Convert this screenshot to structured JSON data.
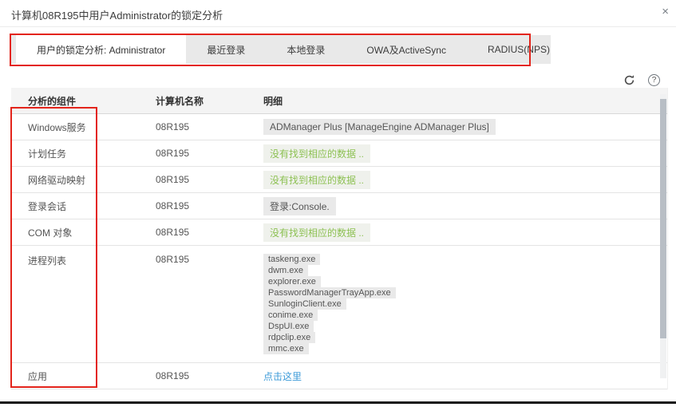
{
  "dialog": {
    "title": "计算机08R195中用户Administrator的锁定分析",
    "close_icon": "×"
  },
  "tabs": [
    {
      "id": "lockout-analysis",
      "label": "用户的锁定分析: Administrator",
      "active": true
    },
    {
      "id": "recent-logon",
      "label": "最近登录",
      "active": false
    },
    {
      "id": "local-logon",
      "label": "本地登录",
      "active": false
    },
    {
      "id": "owa-activesync",
      "label": "OWA及ActiveSync",
      "active": false
    },
    {
      "id": "radius-nps",
      "label": "RADIUS(NPS)",
      "active": false
    }
  ],
  "toolbar": {
    "help_icon": "?"
  },
  "table": {
    "columns": [
      "分析的组件",
      "计算机名称",
      "明细"
    ],
    "rows": [
      {
        "component": "Windows服务",
        "computer": "08R195",
        "detail_type": "badge",
        "detail": "ADManager Plus [ManageEngine ADManager Plus]"
      },
      {
        "component": "计划任务",
        "computer": "08R195",
        "detail_type": "nodata",
        "detail": "没有找到相应的数据 .."
      },
      {
        "component": "网络驱动映射",
        "computer": "08R195",
        "detail_type": "nodata",
        "detail": "没有找到相应的数据 .."
      },
      {
        "component": "登录会话",
        "computer": "08R195",
        "detail_type": "badge",
        "detail": "登录:Console."
      },
      {
        "component": "COM 对象",
        "computer": "08R195",
        "detail_type": "nodata",
        "detail": "没有找到相应的数据 .."
      },
      {
        "component": "进程列表",
        "computer": "08R195",
        "detail_type": "list",
        "detail_list": [
          "taskeng.exe",
          "dwm.exe",
          "explorer.exe",
          "PasswordManagerTrayApp.exe",
          "SunloginClient.exe",
          "conime.exe",
          "DspUI.exe",
          "rdpclip.exe",
          "mmc.exe"
        ]
      },
      {
        "component": "应用",
        "computer": "08R195",
        "detail_type": "link",
        "detail": "点击这里"
      }
    ]
  },
  "colors": {
    "annotation_red": "#e3241b",
    "link_blue": "#3d9bd8",
    "nodata_green": "#8dc153",
    "badge_bg": "#e9e9e9",
    "badge_text": "#555555",
    "scrollbar_thumb": "#b8bec5",
    "tabbar_bg": "#e9e9e9"
  }
}
